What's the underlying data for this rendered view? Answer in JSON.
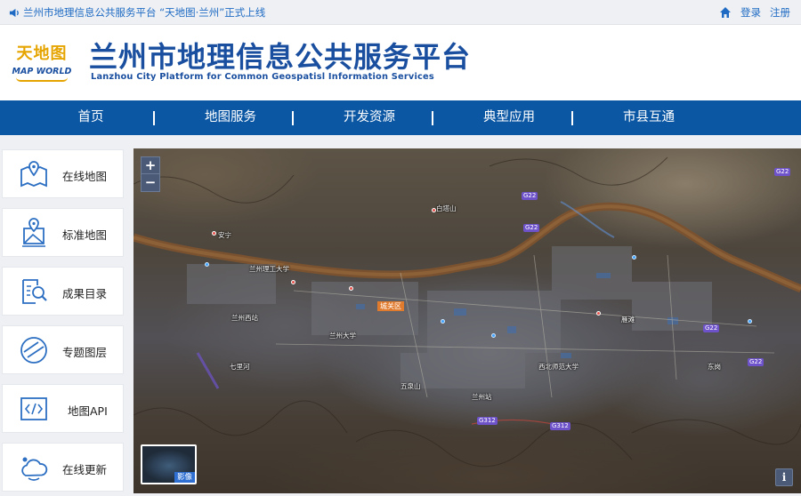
{
  "topbar": {
    "notice": "兰州市地理信息公共服务平台 “天地图·兰州”正式上线",
    "login": "登录",
    "register": "注册"
  },
  "header": {
    "logo_cn": "天地图",
    "logo_en": "MAP WORLD",
    "title": "兰州市地理信息公共服务平台",
    "subtitle": "Lanzhou City Platform for Common Geospatisl Information Services"
  },
  "nav": {
    "items": [
      {
        "label": "首页"
      },
      {
        "label": "地图服务"
      },
      {
        "label": "开发资源"
      },
      {
        "label": "典型应用"
      },
      {
        "label": "市县互通"
      }
    ]
  },
  "sidebar": {
    "items": [
      {
        "label": "在线地图",
        "icon": "map-pin-icon"
      },
      {
        "label": "标准地图",
        "icon": "standard-map-icon"
      },
      {
        "label": "成果目录",
        "icon": "catalog-search-icon"
      },
      {
        "label": "专题图层",
        "icon": "layer-icon"
      },
      {
        "label": "地图API",
        "icon": "code-icon"
      },
      {
        "label": "在线更新",
        "icon": "cloud-update-icon"
      }
    ]
  },
  "map": {
    "zoom_in": "+",
    "zoom_out": "−",
    "district_label": "城关区",
    "basemap_toggle": "影像",
    "info_button": "i",
    "road_badges": [
      "G22",
      "G22",
      "G22",
      "G22",
      "G22",
      "G312",
      "G312"
    ],
    "labels": [
      "兰州大学",
      "兰州站",
      "兰州西站",
      "雁滩",
      "东岗",
      "五泉山",
      "白塔山",
      "兰州理工大学",
      "西北师范大学",
      "七里河",
      "安宁"
    ]
  },
  "colors": {
    "brand_blue": "#1a4fa0",
    "nav_blue": "#0b57a4",
    "link_blue": "#1f6bc4",
    "logo_gold": "#e5a400",
    "district_orange": "#e07a2c",
    "road_purple": "#6d52c9"
  }
}
